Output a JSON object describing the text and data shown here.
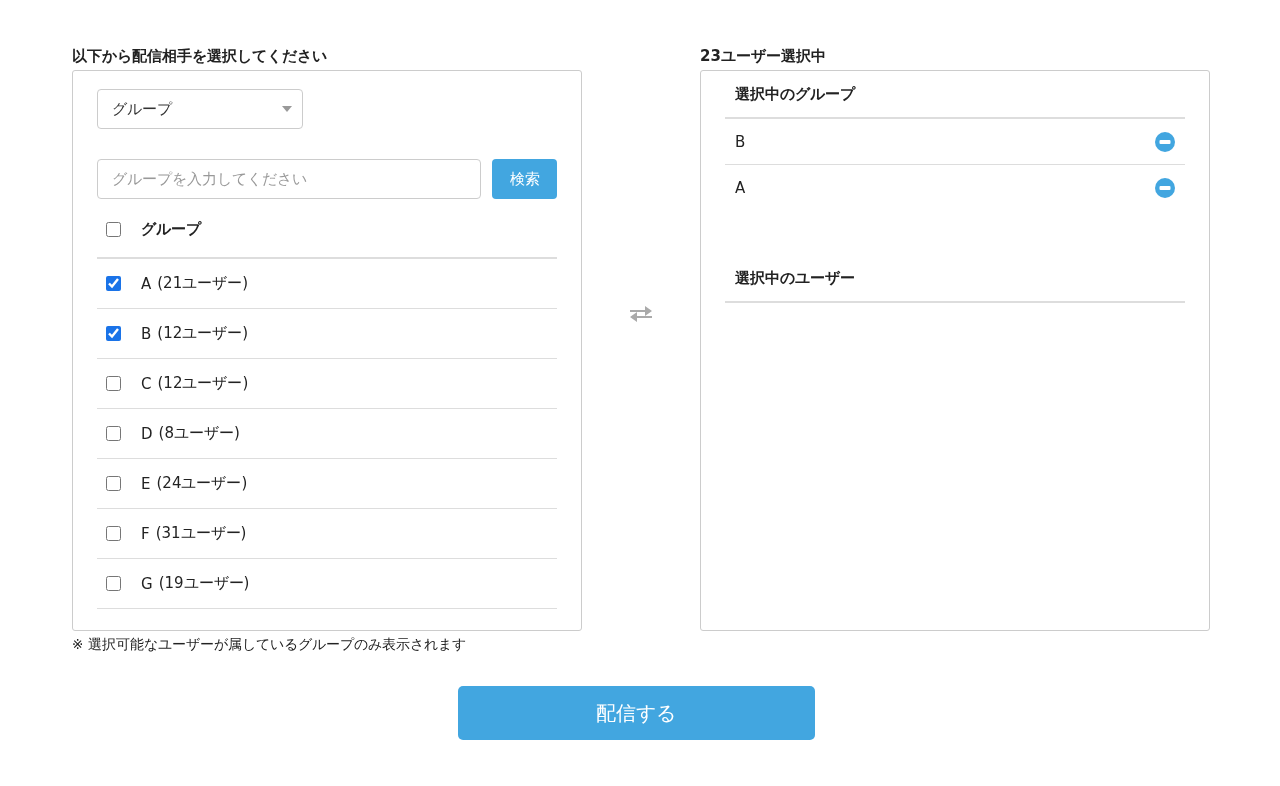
{
  "left": {
    "title": "以下から配信相手を選択してください",
    "type_select": {
      "value": "グループ"
    },
    "search": {
      "placeholder": "グループを入力してください",
      "button": "検索"
    },
    "header": {
      "label": "グループ",
      "checked": false
    },
    "groups": [
      {
        "name": "A",
        "count": "(21ユーザー)",
        "checked": true
      },
      {
        "name": "B",
        "count": "(12ユーザー)",
        "checked": true
      },
      {
        "name": "C",
        "count": "(12ユーザー)",
        "checked": false
      },
      {
        "name": "D",
        "count": "(8ユーザー)",
        "checked": false
      },
      {
        "name": "E",
        "count": "(24ユーザー)",
        "checked": false
      },
      {
        "name": "F",
        "count": "(31ユーザー)",
        "checked": false
      },
      {
        "name": "G",
        "count": "(19ユーザー)",
        "checked": false
      }
    ],
    "note": "※ 選択可能なユーザーが属しているグループのみ表示されます"
  },
  "right": {
    "title": "23ユーザー選択中",
    "selected_groups": {
      "heading": "選択中のグループ",
      "items": [
        "B",
        "A"
      ]
    },
    "selected_users": {
      "heading": "選択中のユーザー"
    }
  },
  "submit": "配信する"
}
